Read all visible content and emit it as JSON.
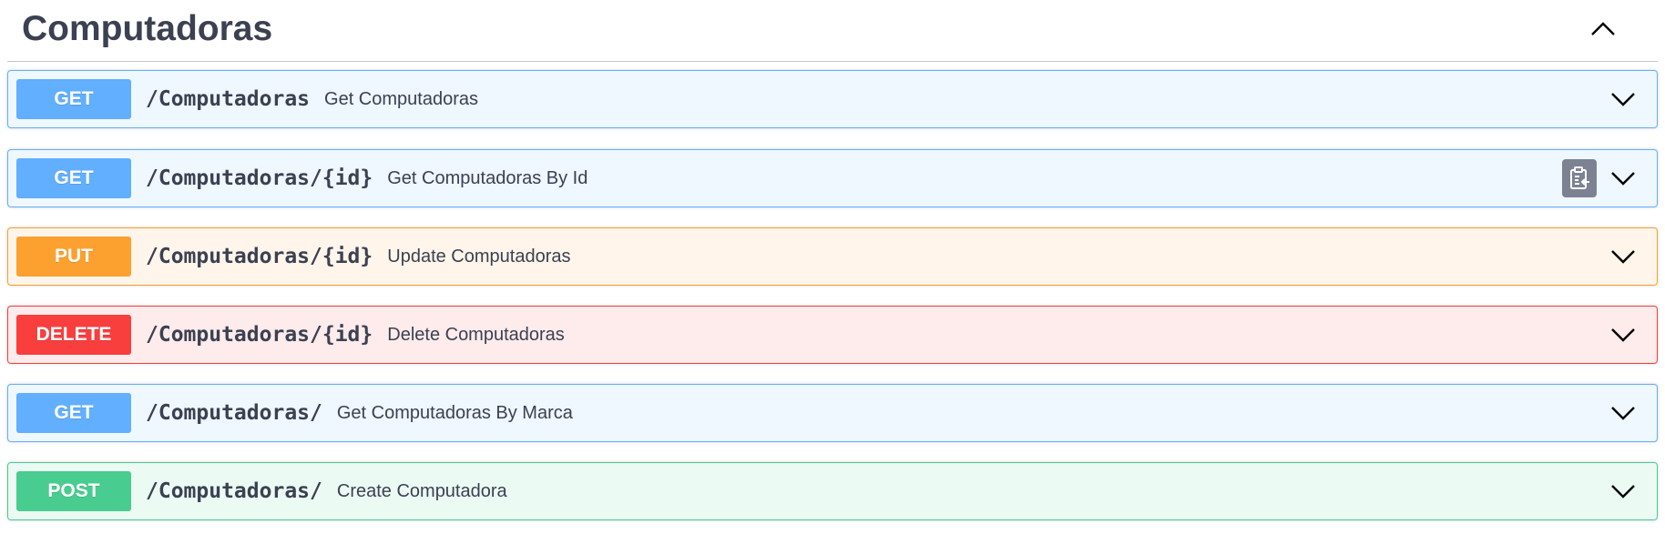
{
  "tag": {
    "title": "Computadoras"
  },
  "operations": [
    {
      "method": "GET",
      "path": "/Computadoras",
      "summary": "Get Computadoras"
    },
    {
      "method": "GET",
      "path": "/Computadoras/{id}",
      "summary": "Get Computadoras By Id"
    },
    {
      "method": "PUT",
      "path": "/Computadoras/{id}",
      "summary": "Update Computadoras"
    },
    {
      "method": "DELETE",
      "path": "/Computadoras/{id}",
      "summary": "Delete Computadoras"
    },
    {
      "method": "GET",
      "path": "/Computadoras/",
      "summary": "Get Computadoras By Marca"
    },
    {
      "method": "POST",
      "path": "/Computadoras/",
      "summary": "Create Computadora"
    }
  ],
  "icons": {
    "tag_toggle": "chevron-up-icon",
    "expand": "chevron-down-icon",
    "copy": "clipboard-icon"
  },
  "colors": {
    "get": "#61affe",
    "put": "#fca130",
    "delete": "#f93e3e",
    "post": "#49cc90",
    "text": "#3b4151"
  }
}
